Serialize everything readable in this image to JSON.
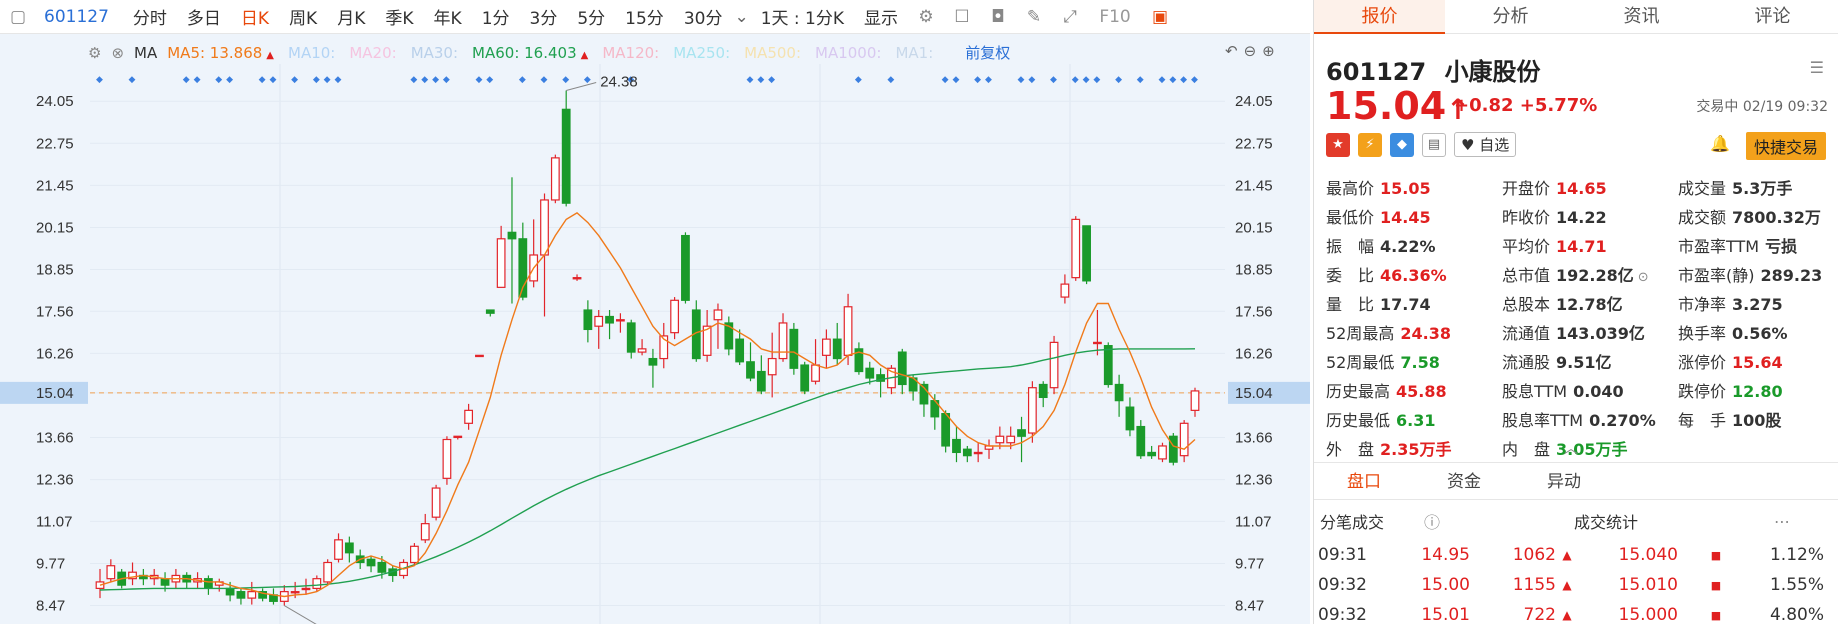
{
  "toolbar": {
    "code": "601127",
    "tabs": [
      "分时",
      "多日",
      "日K",
      "周K",
      "月K",
      "季K",
      "年K",
      "1分",
      "3分",
      "5分",
      "15分",
      "30分"
    ],
    "active_tab": "日K",
    "period": "1天 : 1分K",
    "display": "显示",
    "f10": "F10"
  },
  "ma_legend": {
    "label": "MA",
    "items": [
      {
        "text": "MA5: 13.868",
        "color": "#f07a1a",
        "arrow": "▲"
      },
      {
        "text": "MA10:",
        "color": "#b3d4f5"
      },
      {
        "text": "MA20:",
        "color": "#f5c4e0"
      },
      {
        "text": "MA30:",
        "color": "#b9d0ea"
      },
      {
        "text": "MA60: 16.403",
        "color": "#20a050",
        "arrow": "▲"
      },
      {
        "text": "MA120:",
        "color": "#f5b8c8"
      },
      {
        "text": "MA250:",
        "color": "#a8e4f0"
      },
      {
        "text": "MA500:",
        "color": "#f5e2b0"
      },
      {
        "text": "MA1000:",
        "color": "#d8c8f0"
      },
      {
        "text": "MA1:",
        "color": "#c8d8ea"
      }
    ],
    "fq": "前复权"
  },
  "chart_data": {
    "type": "candlestick",
    "y_ticks": [
      24.05,
      22.75,
      21.45,
      20.15,
      18.85,
      17.56,
      16.26,
      15.04,
      13.66,
      12.36,
      11.07,
      9.77,
      8.47
    ],
    "current_price": 15.04,
    "high_label": "24.38",
    "low_label": "8.47",
    "ylim": [
      7.9,
      25.2
    ],
    "candles": [
      [
        9.0,
        9.2,
        8.7,
        9.6
      ],
      [
        9.3,
        9.7,
        9.2,
        9.9
      ],
      [
        9.5,
        9.1,
        9.0,
        9.6
      ],
      [
        9.3,
        9.5,
        9.1,
        9.8
      ],
      [
        9.4,
        9.3,
        9.1,
        9.6
      ],
      [
        9.3,
        9.4,
        9.1,
        9.6
      ],
      [
        9.3,
        9.1,
        8.9,
        9.5
      ],
      [
        9.2,
        9.4,
        9.0,
        9.6
      ],
      [
        9.4,
        9.2,
        9.0,
        9.5
      ],
      [
        9.2,
        9.3,
        9.0,
        9.5
      ],
      [
        9.3,
        9.0,
        8.8,
        9.4
      ],
      [
        9.1,
        9.2,
        8.9,
        9.3
      ],
      [
        9.0,
        8.8,
        8.6,
        9.2
      ],
      [
        8.9,
        8.7,
        8.5,
        9.0
      ],
      [
        8.7,
        8.9,
        8.5,
        9.2
      ],
      [
        8.9,
        8.7,
        8.6,
        9.0
      ],
      [
        8.8,
        8.6,
        8.5,
        9.0
      ],
      [
        8.6,
        8.9,
        8.47,
        9.1
      ],
      [
        8.9,
        8.9,
        8.7,
        9.2
      ],
      [
        9.0,
        9.0,
        8.8,
        9.3
      ],
      [
        9.0,
        9.3,
        8.9,
        9.4
      ],
      [
        9.2,
        9.8,
        9.1,
        9.9
      ],
      [
        9.9,
        10.5,
        9.8,
        10.7
      ],
      [
        10.4,
        10.1,
        9.8,
        10.6
      ],
      [
        10.0,
        9.8,
        9.6,
        10.2
      ],
      [
        9.9,
        9.7,
        9.5,
        10.0
      ],
      [
        9.8,
        9.5,
        9.3,
        10.0
      ],
      [
        9.6,
        9.4,
        9.2,
        9.7
      ],
      [
        9.4,
        9.8,
        9.3,
        9.9
      ],
      [
        9.8,
        10.3,
        9.7,
        10.4
      ],
      [
        10.5,
        11.0,
        10.4,
        11.3
      ],
      [
        11.2,
        12.1,
        11.1,
        12.2
      ],
      [
        12.4,
        13.6,
        12.2,
        13.7
      ],
      [
        13.7,
        13.7,
        13.6,
        13.7
      ],
      [
        14.1,
        14.5,
        13.9,
        14.7
      ],
      [
        16.2,
        16.2,
        16.2,
        16.2
      ],
      [
        17.6,
        17.5,
        17.4,
        17.6
      ],
      [
        18.3,
        19.8,
        18.3,
        20.2
      ],
      [
        20.0,
        19.8,
        17.8,
        21.7
      ],
      [
        19.8,
        18.0,
        17.9,
        20.3
      ],
      [
        18.5,
        19.3,
        18.3,
        20.4
      ],
      [
        19.3,
        21.0,
        17.4,
        21.2
      ],
      [
        21.0,
        22.3,
        20.9,
        22.4
      ],
      [
        23.8,
        20.9,
        20.8,
        24.38
      ],
      [
        18.6,
        18.6,
        18.5,
        18.7
      ],
      [
        17.6,
        17.0,
        16.6,
        17.9
      ],
      [
        17.1,
        17.4,
        16.4,
        17.6
      ],
      [
        17.4,
        17.2,
        16.7,
        17.6
      ],
      [
        17.3,
        17.3,
        16.9,
        17.5
      ],
      [
        17.2,
        16.3,
        16.1,
        17.3
      ],
      [
        16.3,
        16.4,
        16.2,
        16.7
      ],
      [
        16.1,
        15.9,
        15.2,
        16.4
      ],
      [
        16.1,
        16.8,
        15.8,
        17.2
      ],
      [
        16.9,
        17.9,
        16.7,
        18.0
      ],
      [
        19.9,
        17.9,
        17.8,
        20.0
      ],
      [
        17.6,
        16.1,
        16.0,
        17.9
      ],
      [
        16.2,
        17.1,
        16.0,
        17.6
      ],
      [
        17.3,
        17.6,
        16.4,
        17.8
      ],
      [
        17.2,
        16.4,
        16.2,
        17.4
      ],
      [
        16.7,
        16.0,
        15.9,
        17.0
      ],
      [
        16.0,
        15.5,
        15.4,
        16.6
      ],
      [
        15.7,
        15.1,
        15.0,
        16.2
      ],
      [
        15.6,
        16.1,
        14.9,
        16.9
      ],
      [
        16.1,
        17.2,
        16.0,
        17.5
      ],
      [
        17.0,
        15.8,
        15.6,
        17.2
      ],
      [
        15.9,
        15.1,
        15.0,
        16.0
      ],
      [
        15.4,
        15.9,
        15.3,
        16.7
      ],
      [
        16.2,
        16.7,
        15.8,
        17.0
      ],
      [
        16.7,
        16.1,
        15.9,
        17.2
      ],
      [
        16.2,
        17.7,
        15.9,
        18.1
      ],
      [
        16.4,
        15.7,
        15.6,
        16.6
      ],
      [
        15.8,
        15.5,
        15.3,
        16.0
      ],
      [
        15.6,
        15.4,
        14.9,
        15.8
      ],
      [
        15.2,
        15.8,
        15.0,
        15.9
      ],
      [
        16.3,
        15.3,
        15.0,
        16.4
      ],
      [
        15.5,
        15.1,
        14.8,
        15.6
      ],
      [
        15.3,
        14.7,
        14.3,
        15.4
      ],
      [
        14.8,
        14.3,
        13.9,
        15.0
      ],
      [
        14.4,
        13.4,
        13.2,
        14.5
      ],
      [
        13.6,
        13.2,
        12.9,
        14.0
      ],
      [
        13.3,
        13.1,
        12.9,
        13.4
      ],
      [
        13.2,
        13.2,
        12.9,
        13.5
      ],
      [
        13.3,
        13.4,
        13.0,
        13.6
      ],
      [
        13.5,
        13.7,
        13.3,
        14.0
      ],
      [
        13.5,
        13.7,
        13.3,
        14.0
      ],
      [
        13.9,
        13.7,
        12.9,
        14.3
      ],
      [
        13.8,
        15.2,
        13.5,
        15.4
      ],
      [
        15.3,
        14.9,
        14.6,
        15.4
      ],
      [
        15.2,
        16.6,
        15.0,
        16.8
      ],
      [
        18.0,
        18.4,
        17.8,
        18.7
      ],
      [
        18.6,
        20.4,
        18.5,
        20.5
      ],
      [
        20.2,
        18.5,
        18.4,
        20.1
      ],
      [
        16.6,
        16.6,
        16.2,
        17.6
      ],
      [
        16.5,
        15.3,
        15.2,
        16.6
      ],
      [
        15.3,
        14.8,
        14.3,
        15.6
      ],
      [
        14.6,
        13.9,
        13.7,
        14.9
      ],
      [
        14.0,
        13.1,
        13.0,
        14.2
      ],
      [
        13.2,
        13.1,
        13.0,
        13.4
      ],
      [
        13.0,
        13.4,
        12.9,
        13.5
      ],
      [
        13.7,
        12.9,
        12.8,
        13.8
      ],
      [
        13.1,
        14.1,
        12.9,
        14.2
      ],
      [
        14.5,
        15.1,
        14.3,
        15.2
      ]
    ],
    "ma5": [
      9.1,
      9.2,
      9.3,
      9.35,
      9.4,
      9.35,
      9.3,
      9.3,
      9.3,
      9.25,
      9.2,
      9.2,
      9.1,
      9.0,
      8.95,
      8.85,
      8.8,
      8.75,
      8.8,
      8.82,
      8.9,
      9.1,
      9.4,
      9.7,
      9.9,
      10.0,
      9.9,
      9.7,
      9.6,
      9.7,
      10.1,
      10.7,
      11.4,
      12.2,
      12.9,
      13.9,
      14.9,
      16.2,
      17.3,
      18.3,
      18.9,
      19.3,
      19.9,
      20.4,
      20.6,
      20.3,
      19.9,
      19.4,
      18.9,
      18.3,
      17.7,
      17.1,
      16.7,
      16.5,
      16.7,
      16.9,
      17.0,
      17.2,
      17.1,
      16.9,
      16.7,
      16.4,
      16.3,
      16.3,
      16.3,
      16.1,
      15.9,
      15.8,
      15.9,
      16.2,
      16.3,
      16.2,
      15.9,
      15.7,
      15.6,
      15.5,
      15.2,
      14.8,
      14.4,
      14.0,
      13.7,
      13.5,
      13.4,
      13.4,
      13.4,
      13.5,
      13.7,
      14.0,
      14.5,
      15.3,
      16.3,
      17.2,
      17.8,
      17.8,
      17.0,
      16.3,
      15.5,
      14.6,
      13.9,
      13.4,
      13.3,
      13.6
    ],
    "ma60_start": 0,
    "ma60": [
      8.95,
      8.96,
      8.97,
      8.98,
      8.99,
      9.0,
      9.0,
      9.0,
      9.0,
      9.0,
      9.0,
      9.0,
      9.0,
      9.01,
      9.02,
      9.03,
      9.04,
      9.05,
      9.06,
      9.08,
      9.1,
      9.13,
      9.17,
      9.22,
      9.28,
      9.35,
      9.43,
      9.52,
      9.62,
      9.73,
      9.85,
      9.98,
      10.12,
      10.27,
      10.43,
      10.6,
      10.78,
      10.97,
      11.17,
      11.36,
      11.55,
      11.73,
      11.9,
      12.06,
      12.21,
      12.35,
      12.48,
      12.6,
      12.72,
      12.84,
      12.96,
      13.08,
      13.2,
      13.32,
      13.44,
      13.56,
      13.68,
      13.8,
      13.92,
      14.04,
      14.16,
      14.28,
      14.4,
      14.52,
      14.64,
      14.76,
      14.88,
      15.0,
      15.1,
      15.2,
      15.3,
      15.38,
      15.45,
      15.51,
      15.56,
      15.6,
      15.63,
      15.66,
      15.69,
      15.72,
      15.75,
      15.78,
      15.8,
      15.82,
      15.85,
      15.9,
      15.97,
      16.05,
      16.12,
      16.2,
      16.27,
      16.32,
      16.36,
      16.38,
      16.4,
      16.4,
      16.4,
      16.4,
      16.4,
      16.4,
      16.4,
      16.403
    ]
  },
  "panel": {
    "tabs": [
      "报价",
      "分析",
      "资讯",
      "评论"
    ],
    "code": "601127",
    "name": "小康股份",
    "price": "15.04",
    "arrow": "↑",
    "change": "+0.82",
    "change_pct": "+5.77%",
    "trade_time": "交易中 02/19 09:32",
    "watch_label": "自选",
    "fast_trade": "快捷交易",
    "stats": [
      {
        "k": "最高价",
        "v": "15.05",
        "c": "red"
      },
      {
        "k": "开盘价",
        "v": "14.65",
        "c": "red"
      },
      {
        "k": "成交量",
        "v": "5.3万手",
        "c": ""
      },
      {
        "k": "最低价",
        "v": "14.45",
        "c": "red"
      },
      {
        "k": "昨收价",
        "v": "14.22",
        "c": ""
      },
      {
        "k": "成交额",
        "v": "7800.32万",
        "c": ""
      },
      {
        "k": "振　幅",
        "v": "4.22%",
        "c": ""
      },
      {
        "k": "平均价",
        "v": "14.71",
        "c": "red"
      },
      {
        "k": "市盈率TTM",
        "v": "亏损",
        "c": ""
      },
      {
        "k": "委　比",
        "v": "46.36%",
        "c": "red"
      },
      {
        "k": "总市值",
        "v": "192.28亿",
        "c": ""
      },
      {
        "k": "市盈率(静)",
        "v": "289.23",
        "c": ""
      },
      {
        "k": "量　比",
        "v": "17.74",
        "c": ""
      },
      {
        "k": "总股本",
        "v": "12.78亿",
        "c": ""
      },
      {
        "k": "市净率",
        "v": "3.275",
        "c": ""
      },
      {
        "k": "52周最高",
        "v": "24.38",
        "c": "red"
      },
      {
        "k": "流通值",
        "v": "143.039亿",
        "c": ""
      },
      {
        "k": "换手率",
        "v": "0.56%",
        "c": ""
      },
      {
        "k": "52周最低",
        "v": "7.58",
        "c": "green"
      },
      {
        "k": "流通股",
        "v": "9.51亿",
        "c": ""
      },
      {
        "k": "涨停价",
        "v": "15.64",
        "c": "red"
      },
      {
        "k": "历史最高",
        "v": "45.88",
        "c": "red"
      },
      {
        "k": "股息TTM",
        "v": "0.040",
        "c": ""
      },
      {
        "k": "跌停价",
        "v": "12.80",
        "c": "green"
      },
      {
        "k": "历史最低",
        "v": "6.31",
        "c": "green"
      },
      {
        "k": "股息率TTM",
        "v": "0.270%",
        "c": ""
      },
      {
        "k": "每　手",
        "v": "100股",
        "c": ""
      },
      {
        "k": "外　盘",
        "v": "2.35万手",
        "c": "red"
      },
      {
        "k": "内　盘",
        "v": "3.05万手",
        "c": "green"
      },
      {
        "k": "",
        "v": "",
        "c": ""
      }
    ],
    "subtabs": [
      "盘口",
      "资金",
      "异动"
    ],
    "trades_title": "分笔成交",
    "stats_title": "成交统计",
    "trades": [
      {
        "t": "09:31",
        "p": "14.95",
        "vol": "1062",
        "sp": "15.040",
        "pct": "1.12%"
      },
      {
        "t": "09:32",
        "p": "15.00",
        "vol": "1155",
        "sp": "15.010",
        "pct": "1.55%"
      },
      {
        "t": "09:32",
        "p": "15.01",
        "vol": "722",
        "sp": "15.000",
        "pct": "4.80%"
      }
    ]
  }
}
